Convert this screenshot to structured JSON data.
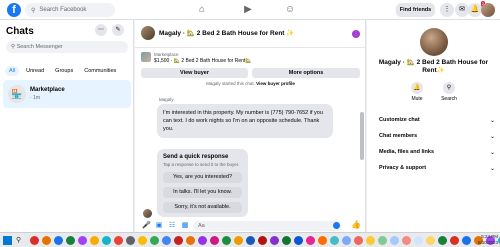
{
  "topbar": {
    "logo": "f",
    "search_placeholder": "Search Facebook",
    "find_friends": "Find friends",
    "notification_count": "2",
    "icons": [
      "home-icon",
      "watch-icon",
      "groups-icon",
      "grid-menu-icon",
      "messenger-icon",
      "bell-icon"
    ]
  },
  "sidebar": {
    "title": "Chats",
    "search_placeholder": "Search Messenger",
    "filters": [
      "All",
      "Unread",
      "Groups",
      "Communities"
    ],
    "active_filter": "All",
    "chat": {
      "name": "Marketplace",
      "time": "· 1m"
    }
  },
  "conversation": {
    "title": "Magaly · 🏡 2 Bed 2 Bath House for Rent ✨",
    "listing_source": "Marketplace",
    "listing_info": "$1,500 · 🏡 2 Bed 2 Bath House for Rent🏡",
    "view_buyer": "View buyer",
    "more_options": "More options",
    "system_prefix": "Magaly started this chat.",
    "system_link": "View buyer profile",
    "sender": "Magaly",
    "message": "I'm interested in this property. My number is (775) 790-7652 if you can text. I do work nights so I'm on an opposite schedule. Thank you.",
    "quick_reply": {
      "title": "Send a quick response",
      "subtitle": "Tap a response to send it to the buyer.",
      "options": [
        "Yes, are you interested?",
        "In talks. I'll let you know.",
        "Sorry, it's not available."
      ]
    },
    "composer_placeholder": "Aa"
  },
  "details": {
    "title": "Magaly · 🏡 2 Bed 2 Bath House for Rent✨",
    "actions": [
      {
        "label": "Mute",
        "icon": "bell-icon"
      },
      {
        "label": "Search",
        "icon": "search-icon"
      }
    ],
    "rows": [
      "Customize chat",
      "Chat members",
      "Media, files and links",
      "Privacy & support"
    ]
  },
  "taskbar": {
    "time": "5:24 PM",
    "date": "8/10/2023",
    "app_colors": [
      "#d93025",
      "#e37400",
      "#1a73e8",
      "#188038",
      "#a142f4",
      "#f9ab00",
      "#12b5cb",
      "#ea4335",
      "#5f6368",
      "#fbbc04",
      "#34a853",
      "#4285f4",
      "#c5221f",
      "#e8710a",
      "#9334e6",
      "#d01884",
      "#1e8e3e",
      "#f29900",
      "#185abc",
      "#b31412",
      "#8430ce",
      "#137333",
      "#0b57d0",
      "#e52592",
      "#ff6d01",
      "#46bdc6",
      "#7baaf7",
      "#ee675c",
      "#fcc934",
      "#81c995",
      "#a8c7fa",
      "#f28b82",
      "#d2e3fc",
      "#fdd663",
      "#188038",
      "#d93025",
      "#1a73e8",
      "#e37400",
      "#a142f4",
      "#12b5cb"
    ]
  }
}
